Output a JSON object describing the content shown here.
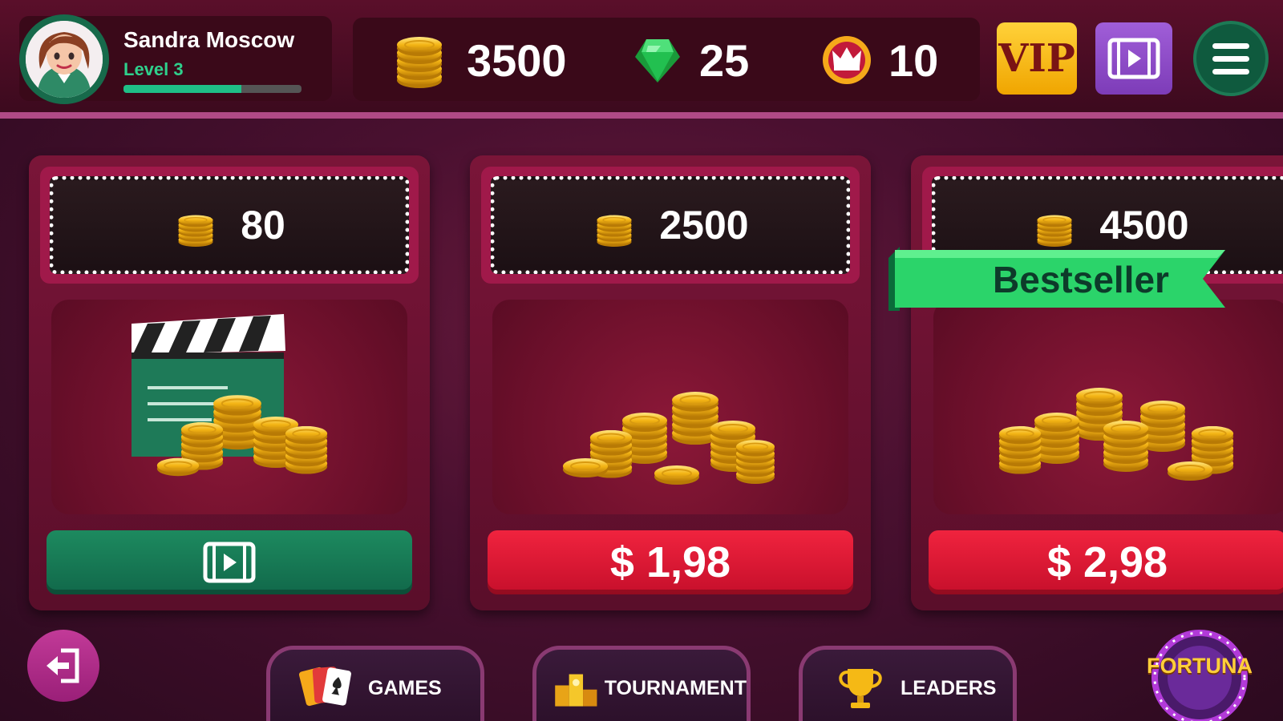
{
  "player": {
    "name": "Sandra Moscow",
    "level": "Level 3",
    "xp_fraction": 0.66
  },
  "currency": {
    "coins": "3500",
    "gems": "25",
    "crowns": "10"
  },
  "top_buttons": {
    "vip": "VIP"
  },
  "offers": [
    {
      "amount": "80",
      "button": "",
      "type": "video"
    },
    {
      "amount": "2500",
      "button": "$ 1,98",
      "type": "purchase"
    },
    {
      "amount": "4500",
      "button": "$ 2,98",
      "type": "purchase",
      "badge": "Bestseller"
    }
  ],
  "nav": {
    "games": "GAMES",
    "tournament": "TOURNAMENT",
    "leaders": "LEADERS",
    "fortuna": "FORTUNA"
  },
  "icons": [
    "coin-stack-icon",
    "gem-icon",
    "crown-icon",
    "vip-icon",
    "video-icon",
    "menu-icon",
    "exit-icon",
    "cards-icon",
    "podium-icon",
    "trophy-icon",
    "fortuna-wheel-icon"
  ],
  "colors": {
    "accent_green": "#1fbf87",
    "buy_red": "#e51a36",
    "vip_gold": "#ffd23a",
    "video_purple": "#8e4bc8"
  }
}
